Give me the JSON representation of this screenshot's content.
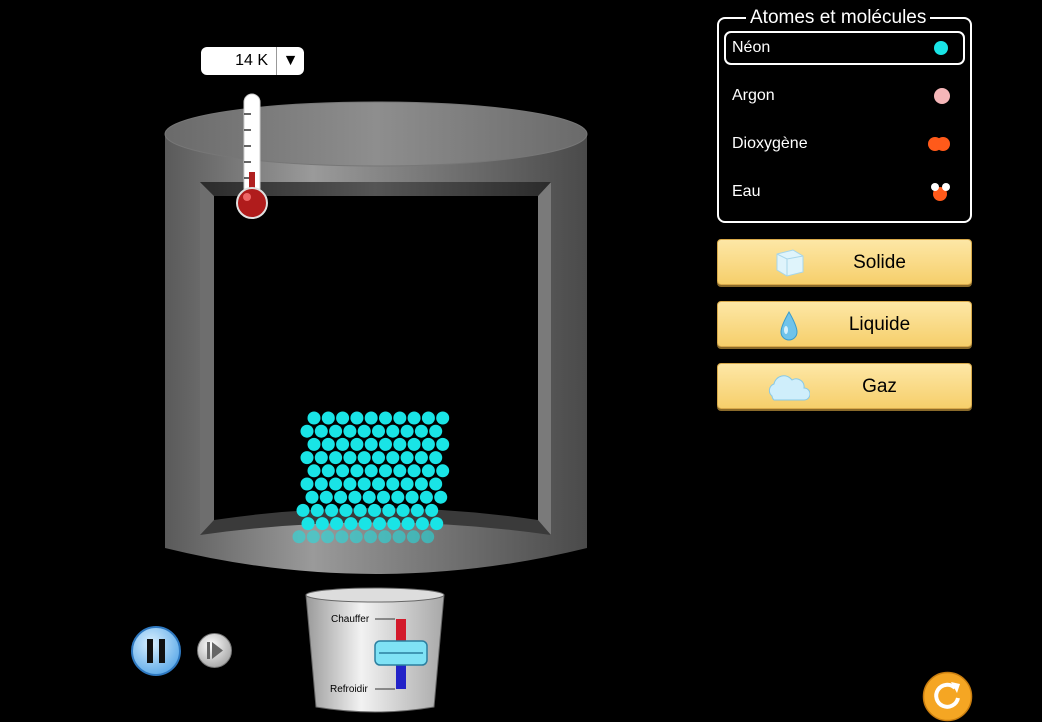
{
  "temperature": {
    "value": "14 K",
    "dropdown_arrow": "▼"
  },
  "molecules_panel": {
    "title": "Atomes et molécules",
    "items": [
      {
        "label": "Néon",
        "selected": true,
        "icon": "neon-atom-icon",
        "color": "#19e4e6"
      },
      {
        "label": "Argon",
        "selected": false,
        "icon": "argon-atom-icon",
        "color": "#f5b6b8"
      },
      {
        "label": "Dioxygène",
        "selected": false,
        "icon": "oxygen-molecule-icon",
        "color": "#ff5a1a"
      },
      {
        "label": "Eau",
        "selected": false,
        "icon": "water-molecule-icon",
        "color": "#ff5a1a"
      }
    ]
  },
  "phases": [
    {
      "label": "Solide",
      "icon": "ice-cube-icon"
    },
    {
      "label": "Liquide",
      "icon": "water-drop-icon"
    },
    {
      "label": "Gaz",
      "icon": "cloud-icon"
    }
  ],
  "heater": {
    "heat_label": "Chauffer",
    "cool_label": "Refroidir",
    "slider_level": 0
  },
  "colors": {
    "particle": "#19e4e6",
    "button_fill": "#f9d87e",
    "accent_reset": "#f5a623"
  }
}
